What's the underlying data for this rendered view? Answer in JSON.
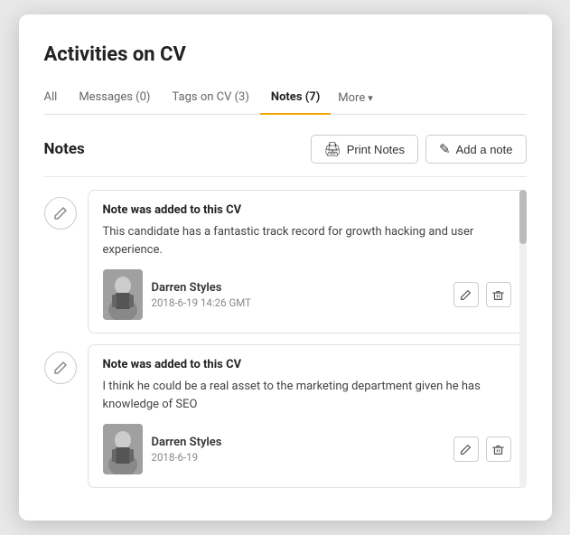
{
  "window": {
    "title": "Activities on CV"
  },
  "tabs": [
    {
      "id": "all",
      "label": "All",
      "active": false
    },
    {
      "id": "messages",
      "label": "Messages (0)",
      "active": false
    },
    {
      "id": "tags",
      "label": "Tags on CV (3)",
      "active": false
    },
    {
      "id": "notes",
      "label": "Notes (7)",
      "active": true
    },
    {
      "id": "more",
      "label": "More",
      "active": false
    }
  ],
  "notes_section": {
    "title": "Notes",
    "print_button": "Print Notes",
    "add_button": "Add a note"
  },
  "notes": [
    {
      "id": 1,
      "card_title": "Note was added to this CV",
      "body": "This candidate has a fantastic track record for growth hacking and user experience.",
      "author": "Darren Styles",
      "date": "2018-6-19 14:26 GMT"
    },
    {
      "id": 2,
      "card_title": "Note was added to this CV",
      "body": "I think he could be a real asset to the marketing department given he has knowledge of SEO",
      "author": "Darren Styles",
      "date": "2018-6-19"
    }
  ],
  "icons": {
    "print": "🖨",
    "add": "✎",
    "edit_pencil": "✏",
    "delete_trash": "🗑",
    "note_icon": "✎",
    "chevron_down": "▾"
  },
  "colors": {
    "active_tab_underline": "#f0a500",
    "border": "#e0e0e0",
    "text_primary": "#222",
    "text_secondary": "#666",
    "icon_border": "#ccc"
  }
}
